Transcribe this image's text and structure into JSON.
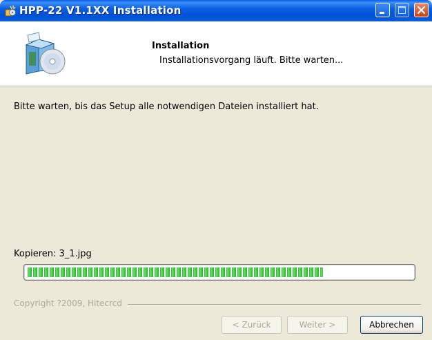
{
  "window": {
    "title": "HPP-22 V1.1XX Installation",
    "controls": [
      "minimize-icon",
      "maximize-icon",
      "close-icon"
    ]
  },
  "header": {
    "title": "Installation",
    "subtitle": "Installationsvorgang läuft. Bitte warten..."
  },
  "main": {
    "message": "Bitte warten, bis das Setup alle notwendigen Dateien installiert hat.",
    "status": "Kopieren: 3_1.jpg",
    "progress": 0.77
  },
  "footer": {
    "copyright": "Copyright ?2009, Hitecrcd",
    "back_label": "< Zurück",
    "next_label": "Weiter >",
    "cancel_label": "Abbrechen"
  },
  "colors": {
    "titlebar": "#0052d6",
    "progress_green": "#2fba2f",
    "background": "#ece9d8"
  }
}
